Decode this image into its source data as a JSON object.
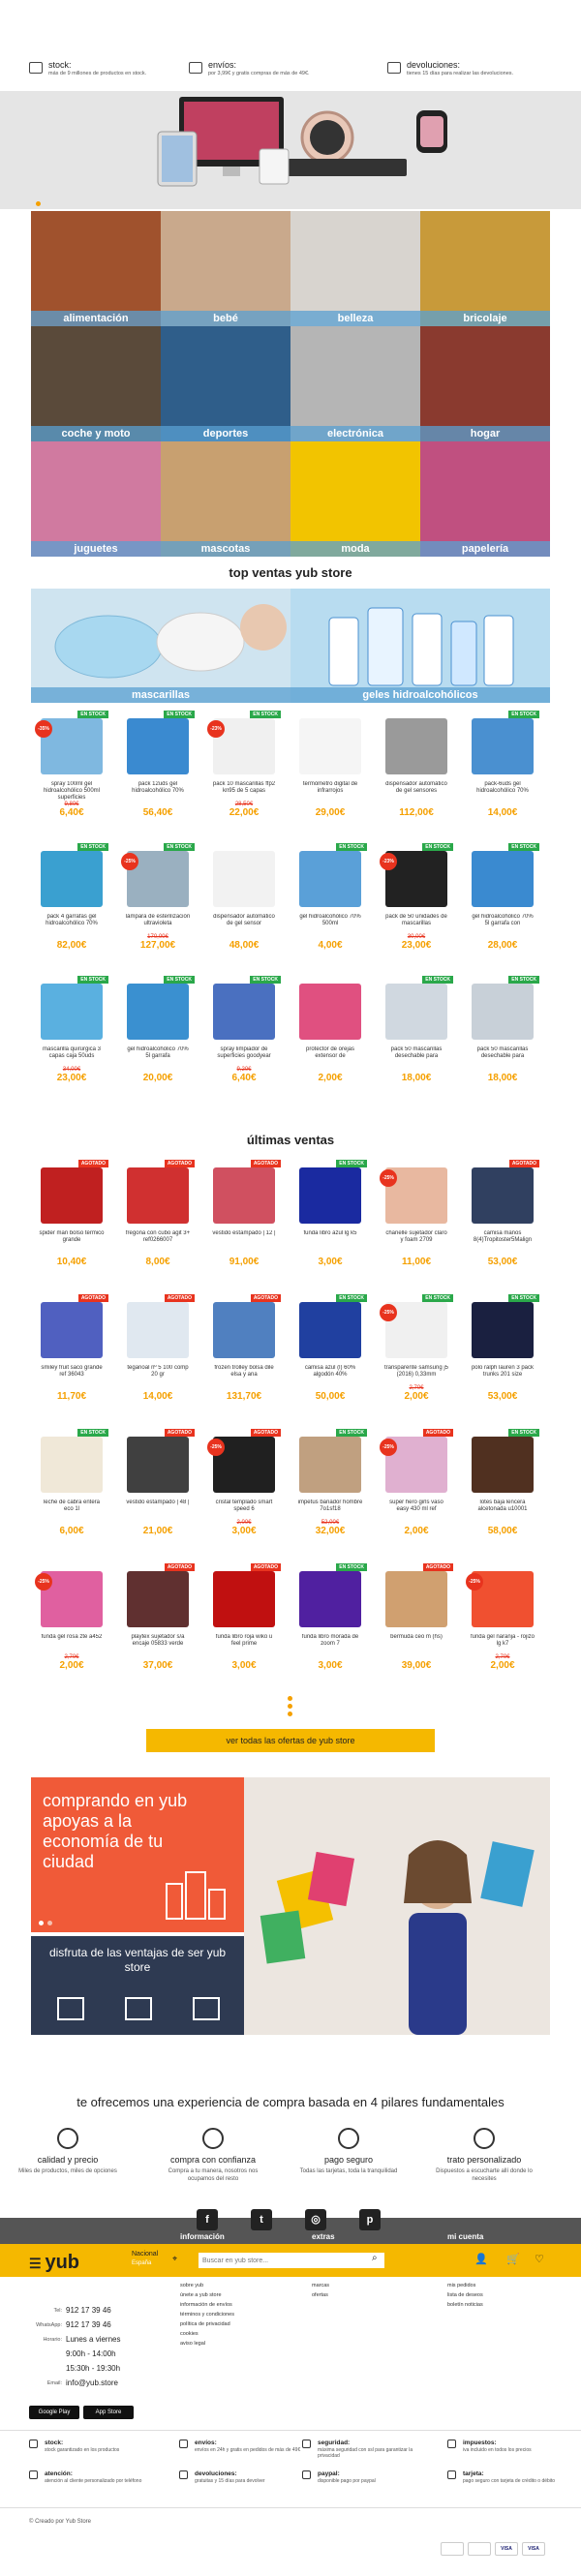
{
  "topbar": [
    {
      "title": "stock:",
      "sub": "más de 9 millones de productos en stock.",
      "icon": "box-icon"
    },
    {
      "title": "envíos:",
      "sub": "por 3,99€ y gratis compras de más de 49€.",
      "icon": "truck-icon"
    },
    {
      "title": "devoluciones:",
      "sub": "tienes 15 días para realizar las devoluciones.",
      "icon": "return-icon"
    }
  ],
  "categories": [
    {
      "label": "alimentación",
      "color": "#a0522d"
    },
    {
      "label": "bebé",
      "color": "#c9a98c"
    },
    {
      "label": "belleza",
      "color": "#d8d4cf"
    },
    {
      "label": "bricolaje",
      "color": "#c89a3a"
    },
    {
      "label": "coche y moto",
      "color": "#5a4a3a"
    },
    {
      "label": "deportes",
      "color": "#2f5e8a"
    },
    {
      "label": "electrónica",
      "color": "#b5b5b5"
    },
    {
      "label": "hogar",
      "color": "#8a3a2f"
    },
    {
      "label": "juguetes",
      "color": "#d07aa0"
    },
    {
      "label": "mascotas",
      "color": "#c8a070"
    },
    {
      "label": "moda",
      "color": "#f2c400"
    },
    {
      "label": "papelería",
      "color": "#c05080"
    }
  ],
  "top_title": "top ventas yub store",
  "banners": [
    {
      "label": "mascarillas"
    },
    {
      "label": "geles hidroalcohólicos"
    }
  ],
  "top_products": [
    {
      "name": "spray 100ml gel hidroalcohólico 500ml superficies",
      "old": "9,80€",
      "price": "6,40€",
      "disc": "-35%",
      "badge": "EN STOCK",
      "c": "#7fb8e0"
    },
    {
      "name": "pack 12uds gel hidroalcohólico 70%",
      "old": "",
      "price": "56,40€",
      "disc": "",
      "badge": "EN STOCK",
      "c": "#3a8ad0"
    },
    {
      "name": "pack 10 mascarillas ffp2 kn95 de 5 capas",
      "old": "28,50€",
      "price": "22,00€",
      "disc": "-23%",
      "badge": "EN STOCK",
      "c": "#f0f0f0"
    },
    {
      "name": "termómetro digital de infrarrojos",
      "old": "",
      "price": "29,00€",
      "disc": "",
      "badge": "",
      "c": "#f5f5f5"
    },
    {
      "name": "dispensador automático de gel sensores",
      "old": "",
      "price": "112,00€",
      "disc": "",
      "badge": "",
      "c": "#9a9a9a"
    },
    {
      "name": "pack-6uds gel hidroalcohólico 70%",
      "old": "",
      "price": "14,00€",
      "disc": "",
      "badge": "EN STOCK",
      "c": "#4a90d0"
    },
    {
      "name": "pack 4 garrafas gel hidroalcohólico 70%",
      "old": "",
      "price": "82,00€",
      "disc": "",
      "badge": "EN STOCK",
      "c": "#3aa0d0"
    },
    {
      "name": "lámpara de esterilización ultravioleta",
      "old": "170,00€",
      "price": "127,00€",
      "disc": "-25%",
      "badge": "EN STOCK",
      "c": "#9ab0c0"
    },
    {
      "name": "dispensador automático de gel sensor",
      "old": "",
      "price": "48,00€",
      "disc": "",
      "badge": "",
      "c": "#f2f2f2"
    },
    {
      "name": "gel hidroalcohólico 70% 500ml",
      "old": "",
      "price": "4,00€",
      "disc": "",
      "badge": "EN STOCK",
      "c": "#5aa0d8"
    },
    {
      "name": "pack de 50 unidades de mascarillas",
      "old": "30,00€",
      "price": "23,00€",
      "disc": "-23%",
      "badge": "EN STOCK",
      "c": "#222"
    },
    {
      "name": "gel hidroalcohólico 70% 5l garrafa con",
      "old": "",
      "price": "28,00€",
      "disc": "",
      "badge": "EN STOCK",
      "c": "#3a8ad0"
    },
    {
      "name": "mascarilla quirúrgica 3 capas caja 50uds",
      "old": "34,00€",
      "price": "23,00€",
      "disc": "",
      "badge": "EN STOCK",
      "c": "#5ab0e0"
    },
    {
      "name": "gel hidroalcohólico 70% 5l garrafa",
      "old": "",
      "price": "20,00€",
      "disc": "",
      "badge": "EN STOCK",
      "c": "#3a90d0"
    },
    {
      "name": "spray limpiador de superficies goodyear",
      "old": "9,20€",
      "price": "6,40€",
      "disc": "",
      "badge": "EN STOCK",
      "c": "#4a70c0"
    },
    {
      "name": "protector de orejas extensor de",
      "old": "",
      "price": "2,00€",
      "disc": "",
      "badge": "",
      "c": "#e05080"
    },
    {
      "name": "pack 50 mascarillas desechable para",
      "old": "",
      "price": "18,00€",
      "disc": "",
      "badge": "EN STOCK",
      "c": "#d0d8e0"
    },
    {
      "name": "pack 50 mascarillas desechable para",
      "old": "",
      "price": "18,00€",
      "disc": "",
      "badge": "EN STOCK",
      "c": "#c8d0d8"
    }
  ],
  "latest_title": "últimas ventas",
  "latest_products": [
    {
      "name": "spider man bolso térmico grande",
      "old": "",
      "price": "10,40€",
      "disc": "",
      "badge": "AGOTADO",
      "c": "#c02020"
    },
    {
      "name": "fregona con cubo agit 3+ ref0266007",
      "old": "",
      "price": "8,00€",
      "disc": "",
      "badge": "AGOTADO",
      "c": "#d03030"
    },
    {
      "name": "vestido estampado | 12 |",
      "old": "",
      "price": "91,00€",
      "disc": "",
      "badge": "AGOTADO",
      "c": "#d05060"
    },
    {
      "name": "funda libro azul lg k5",
      "old": "",
      "price": "3,00€",
      "disc": "",
      "badge": "EN STOCK",
      "c": "#1a2aa0"
    },
    {
      "name": "chanelle sujetador claro y foam 2709",
      "old": "",
      "price": "11,00€",
      "disc": "-25%",
      "badge": "",
      "c": "#e8b8a0"
    },
    {
      "name": "camisa manos 8(4)Tropitoster5Malign",
      "old": "",
      "price": "53,00€",
      "disc": "",
      "badge": "AGOTADO",
      "c": "#304060"
    },
    {
      "name": "smiley fruit saco grande ref 36043",
      "old": "",
      "price": "11,70€",
      "disc": "",
      "badge": "AGOTADO",
      "c": "#5060c0"
    },
    {
      "name": "teganoal nº 5 100 comp 20 gr",
      "old": "",
      "price": "14,00€",
      "disc": "",
      "badge": "AGOTADO",
      "c": "#e0e8f0"
    },
    {
      "name": "frozen trolley bolsa dile elsa y ana",
      "old": "",
      "price": "131,70€",
      "disc": "",
      "badge": "AGOTADO",
      "c": "#5080c0"
    },
    {
      "name": "camisa azul (l) 60% algodón 40%",
      "old": "",
      "price": "50,00€",
      "disc": "",
      "badge": "EN STOCK",
      "c": "#2040a0"
    },
    {
      "name": "transparente samsung j5 (2016) 0,33mm",
      "old": "2,70€",
      "price": "2,00€",
      "disc": "-25%",
      "badge": "EN STOCK",
      "c": "#f0f0f0"
    },
    {
      "name": "polo ralph lauren 3 pack trunks 201 size",
      "old": "",
      "price": "53,00€",
      "disc": "",
      "badge": "EN STOCK",
      "c": "#1a2040"
    },
    {
      "name": "leche de cabra entera eco 1l",
      "old": "",
      "price": "6,00€",
      "disc": "",
      "badge": "EN STOCK",
      "c": "#f0e8d8"
    },
    {
      "name": "vestido estampado | 48 |",
      "old": "",
      "price": "21,00€",
      "disc": "",
      "badge": "AGOTADO",
      "c": "#404040"
    },
    {
      "name": "cristal templado smart speed 6",
      "old": "2,00€",
      "price": "3,00€",
      "disc": "-25%",
      "badge": "AGOTADO",
      "c": "#202020"
    },
    {
      "name": "impetus bañador hombre 7o1sf18",
      "old": "52,00€",
      "price": "32,00€",
      "disc": "",
      "badge": "EN STOCK",
      "c": "#c0a080"
    },
    {
      "name": "super hero girls vaso easy 430 ml ref",
      "old": "",
      "price": "2,00€",
      "disc": "-25%",
      "badge": "AGOTADO",
      "c": "#e0b0d0"
    },
    {
      "name": "lotes baja lencera alcetonada u10001",
      "old": "",
      "price": "58,00€",
      "disc": "",
      "badge": "EN STOCK",
      "c": "#503020"
    },
    {
      "name": "funda gel rosa zte a452",
      "old": "2,70€",
      "price": "2,00€",
      "disc": "-25%",
      "badge": "",
      "c": "#e060a0"
    },
    {
      "name": "playtex sujetador s/a encaje 05833 verde",
      "old": "",
      "price": "37,00€",
      "disc": "",
      "badge": "AGOTADO",
      "c": "#603030"
    },
    {
      "name": "funda libro roja wiko u feel prime",
      "old": "",
      "price": "3,00€",
      "disc": "",
      "badge": "AGOTADO",
      "c": "#c01010"
    },
    {
      "name": "funda libro morada de zoom 7",
      "old": "",
      "price": "3,00€",
      "disc": "",
      "badge": "EN STOCK",
      "c": "#5020a0"
    },
    {
      "name": "bermuda ceo m (hs)",
      "old": "",
      "price": "39,00€",
      "disc": "",
      "badge": "AGOTADO",
      "c": "#d0a070"
    },
    {
      "name": "funda gel naranja - rojizo lg k7",
      "old": "2,70€",
      "price": "2,00€",
      "disc": "-25%",
      "badge": "",
      "c": "#f05030"
    }
  ],
  "cta": "ver todas las ofertas de yub store",
  "promo1": "comprando en yub apoyas a la economía de tu ciudad",
  "promo2": "disfruta de las ventajas de ser yub store",
  "pillars_title": "te ofrecemos una experiencia de compra basada en 4 pilares fundamentales",
  "pillars": [
    {
      "title": "calidad y precio",
      "sub": "Miles de productos, miles de opciones",
      "icon": "tag-icon"
    },
    {
      "title": "compra con confianza",
      "sub": "Compra a tu manera, nosotros nos ocupamos del resto",
      "icon": "shield-icon"
    },
    {
      "title": "pago seguro",
      "sub": "Todas las tarjetas, toda la tranquilidad",
      "icon": "card-icon"
    },
    {
      "title": "trato personalizado",
      "sub": "Dispuestos a escucharte allí donde lo necesites",
      "icon": "handshake-icon"
    }
  ],
  "social": [
    "f",
    "t",
    "◎",
    "p"
  ],
  "header": {
    "logo": "yub",
    "loc_label": "Nacional",
    "loc_sub": "España",
    "search_ph": "Buscar en yub store..."
  },
  "footer_cols": [
    {
      "title": "información",
      "items": [
        "sobre yub",
        "únete a yub store",
        "información de envíos",
        "términos y condiciones",
        "política de privacidad",
        "cookies",
        "aviso legal"
      ]
    },
    {
      "title": "extras",
      "items": [
        "marcas",
        "ofertas"
      ]
    },
    {
      "title": "mi cuenta",
      "items": [
        "mis pedidos",
        "lista de deseos",
        "boletín noticias"
      ]
    }
  ],
  "contact": [
    {
      "k": "Tel:",
      "v": "912 17 39 46"
    },
    {
      "k": "WhatsApp:",
      "v": "912 17 39 46"
    },
    {
      "k": "Horario:",
      "v": "Lunes a viernes"
    },
    {
      "k": "",
      "v": "9:00h - 14:00h"
    },
    {
      "k": "",
      "v": "15:30h - 19:30h"
    },
    {
      "k": "Email:",
      "v": "info@yub.store"
    }
  ],
  "stores": [
    "Google Play",
    "App Store"
  ],
  "features": [
    {
      "t": "stock:",
      "s": "stock garantizado en los productos"
    },
    {
      "t": "envíos:",
      "s": "envíos en 24h y gratis en pedidos de más de 49€"
    },
    {
      "t": "seguridad:",
      "s": "máxima seguridad con ssl para garantizar la privacidad"
    },
    {
      "t": "impuestos:",
      "s": "iva incluido en todos los precios"
    },
    {
      "t": "atención:",
      "s": "atención al cliente personalizado por teléfono"
    },
    {
      "t": "devoluciones:",
      "s": "gratuitas y 15 días para devolver"
    },
    {
      "t": "paypal:",
      "s": "disponible pago por paypal"
    },
    {
      "t": "tarjeta:",
      "s": "pago seguro con tarjeta de crédito o débito"
    }
  ],
  "copyright": "© Creado por Yub Store",
  "payments": [
    "",
    "",
    "VISA",
    "VISA"
  ]
}
